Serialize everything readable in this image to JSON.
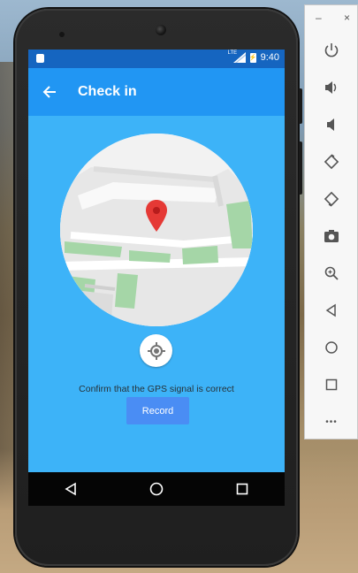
{
  "app": {
    "title": "Check in"
  },
  "status_bar": {
    "time": "9:40",
    "network": "LTE"
  },
  "main": {
    "instruction": "Confirm that the GPS signal is correct",
    "record_label": "Record"
  },
  "emulator": {
    "minimize": "–",
    "close": "×",
    "more": "•••",
    "buttons": [
      "power-icon",
      "volume-up-icon",
      "volume-down-icon",
      "rotate-left-icon",
      "rotate-right-icon",
      "screenshot-icon",
      "zoom-icon",
      "back-icon",
      "home-icon",
      "overview-icon",
      "more-icon"
    ]
  },
  "colors": {
    "status_bar": "#1565c0",
    "toolbar": "#2196f3",
    "screen_bg": "#3db3f8",
    "record_button": "#4a8df4",
    "map_pin": "#e53935",
    "map_green": "#a5d6a7"
  }
}
